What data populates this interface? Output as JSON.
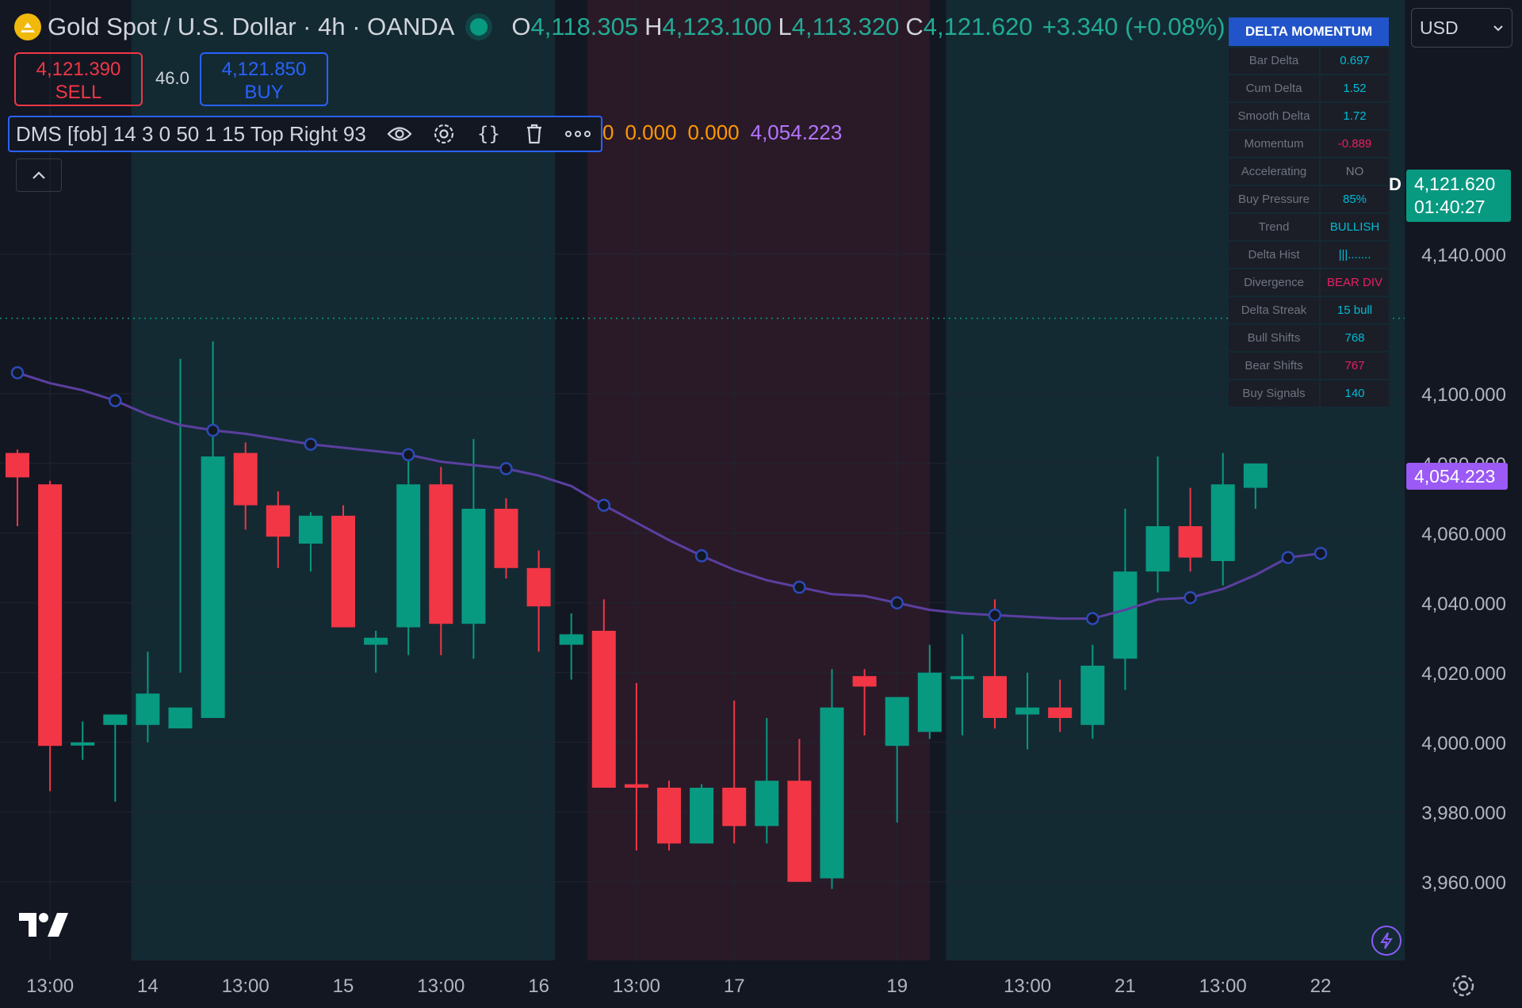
{
  "header": {
    "symbol": "Gold Spot / U.S. Dollar · 4h · OANDA",
    "o_label": "O",
    "o": "4,118.305",
    "h_label": "H",
    "h": "4,123.100",
    "l_label": "L",
    "l": "4,113.320",
    "c_label": "C",
    "c": "4,121.620",
    "change": "+3.340 (+0.08%)"
  },
  "trade": {
    "sell_price": "4,121.390",
    "sell_label": "SELL",
    "spread": "46.0",
    "buy_price": "4,121.850",
    "buy_label": "BUY"
  },
  "indicator": {
    "label": "DMS [fob] 14 3 0 50 1 15 Top Right 93",
    "values": [
      {
        "text": "0",
        "color": "#ff9800"
      },
      {
        "text": "0.000",
        "color": "#ff9800"
      },
      {
        "text": "0.000",
        "color": "#ff9800"
      },
      {
        "text": "4,054.223",
        "color": "#b374ff"
      }
    ],
    "icons": [
      "eye-icon",
      "settings-icon",
      "source-code-icon",
      "trash-icon",
      "more-icon"
    ]
  },
  "currency": "USD",
  "panel": {
    "title": "DELTA MOMENTUM",
    "rows": [
      {
        "label": "Bar Delta",
        "value": "0.697",
        "color": "#00bcd4"
      },
      {
        "label": "Cum Delta",
        "value": "1.52",
        "color": "#00bcd4"
      },
      {
        "label": "Smooth Delta",
        "value": "1.72",
        "color": "#00bcd4"
      },
      {
        "label": "Momentum",
        "value": "-0.889",
        "color": "#e91e63"
      },
      {
        "label": "Accelerating",
        "value": "NO",
        "color": "#787b86"
      },
      {
        "label": "Buy Pressure",
        "value": "85%",
        "color": "#00bcd4"
      },
      {
        "label": "Trend",
        "value": "BULLISH",
        "color": "#00bcd4"
      },
      {
        "label": "Delta Hist",
        "value": "|||.......",
        "color": "#00bcd4"
      },
      {
        "label": "Divergence",
        "value": "BEAR DIV",
        "color": "#e91e63"
      },
      {
        "label": "Delta Streak",
        "value": "15 bull",
        "color": "#00bcd4"
      },
      {
        "label": "Bull Shifts",
        "value": "768",
        "color": "#00bcd4"
      },
      {
        "label": "Bear Shifts",
        "value": "767",
        "color": "#e91e63"
      },
      {
        "label": "Buy Signals",
        "value": "140",
        "color": "#00bcd4"
      }
    ]
  },
  "tags": {
    "price": "4,121.620",
    "countdown": "01:40:27",
    "price_prefix": "D",
    "ema": "4,054.223"
  },
  "colors": {
    "up": "#089981",
    "down": "#f23645",
    "ema": "#5b3fa0",
    "bg": "#131722",
    "bull_zone": "#132a33",
    "bear_zone": "#2a1a28"
  },
  "chart_data": {
    "type": "candlestick",
    "ylim": [
      3950,
      4160
    ],
    "y_ticks": [
      3960,
      3980,
      4000,
      4020,
      4040,
      4060,
      4080,
      4100,
      4140
    ],
    "y_tick_labels": [
      "3,960.000",
      "3,980.000",
      "4,000.000",
      "4,020.000",
      "4,040.000",
      "4,060.000",
      "4,080.000",
      "4,100.000",
      "4,140.000"
    ],
    "x_tick_labels": [
      {
        "text": "13:00",
        "bar": 1
      },
      {
        "text": "14",
        "bar": 4
      },
      {
        "text": "13:00",
        "bar": 7
      },
      {
        "text": "15",
        "bar": 10
      },
      {
        "text": "13:00",
        "bar": 13
      },
      {
        "text": "16",
        "bar": 16
      },
      {
        "text": "13:00",
        "bar": 19
      },
      {
        "text": "17",
        "bar": 22
      },
      {
        "text": "19",
        "bar": 27
      },
      {
        "text": "13:00",
        "bar": 31
      },
      {
        "text": "21",
        "bar": 34
      },
      {
        "text": "13:00",
        "bar": 37
      },
      {
        "text": "22",
        "bar": 40
      }
    ],
    "ohlc": [
      [
        4083,
        4084,
        4062,
        4076
      ],
      [
        4074,
        4075,
        3986,
        3999
      ],
      [
        4000,
        4006,
        3995,
        4000
      ],
      [
        4005,
        4007,
        3983,
        4008
      ],
      [
        4005,
        4026,
        4000,
        4014
      ],
      [
        4004,
        4110,
        4020,
        4010
      ],
      [
        4007,
        4115,
        4024,
        4082
      ],
      [
        4083,
        4086,
        4061,
        4068
      ],
      [
        4068,
        4072,
        4050,
        4059
      ],
      [
        4057,
        4066,
        4049,
        4065
      ],
      [
        4065,
        4068,
        4035,
        4033
      ],
      [
        4028,
        4032,
        4020,
        4030
      ],
      [
        4033,
        4083,
        4025,
        4074
      ],
      [
        4074,
        4079,
        4025,
        4034
      ],
      [
        4034,
        4087,
        4024,
        4067
      ],
      [
        4067,
        4070,
        4047,
        4050
      ],
      [
        4050,
        4055,
        4026,
        4039
      ],
      [
        4028,
        4037,
        4018,
        4031
      ],
      [
        4032,
        4041,
        3997,
        3987
      ],
      [
        3988,
        4017,
        3969,
        3987
      ],
      [
        3987,
        3989,
        3969,
        3971
      ],
      [
        3971,
        3988,
        3973,
        3987
      ],
      [
        3987,
        4012,
        3971,
        3976
      ],
      [
        3976,
        4007,
        3971,
        3989
      ],
      [
        3989,
        4001,
        3964,
        3960
      ],
      [
        3961,
        4021,
        3958,
        4010
      ],
      [
        4019,
        4021,
        4002,
        4016
      ],
      [
        3999,
        4009,
        3977,
        4013
      ],
      [
        4003,
        4028,
        4001,
        4020
      ],
      [
        4019,
        4031,
        4002,
        4019
      ],
      [
        4019,
        4041,
        4004,
        4007
      ],
      [
        4008,
        4020,
        3998,
        4010
      ],
      [
        4010,
        4018,
        4003,
        4007
      ],
      [
        4005,
        4028,
        4001,
        4022
      ],
      [
        4024,
        4067,
        4015,
        4049
      ],
      [
        4049,
        4082,
        4043,
        4062
      ],
      [
        4062,
        4073,
        4049,
        4053
      ],
      [
        4052,
        4083,
        4045,
        4074
      ],
      [
        4073,
        4080,
        4067,
        4080
      ]
    ],
    "ema": [
      4106,
      4103,
      4101,
      4098,
      4094,
      4091,
      4089.5,
      4088.5,
      4087,
      4085.5,
      4084.5,
      4083.5,
      4082.5,
      4080.5,
      4079.5,
      4078.5,
      4076.5,
      4073.5,
      4068,
      4063,
      4058,
      4053.5,
      4049.5,
      4046.5,
      4044.5,
      4042.5,
      4042,
      4040,
      4038,
      4037,
      4036.5,
      4036,
      4035.5,
      4035.5,
      4038,
      4041,
      4041.5,
      4044,
      4048,
      4053,
      4054.2
    ],
    "zones": [
      {
        "from": 4,
        "to": 16,
        "kind": "bull"
      },
      {
        "from": 18,
        "to": 27.5,
        "kind": "bear"
      },
      {
        "from": 29,
        "to": 42.5,
        "kind": "bull"
      }
    ],
    "current_price": 4121.62
  }
}
